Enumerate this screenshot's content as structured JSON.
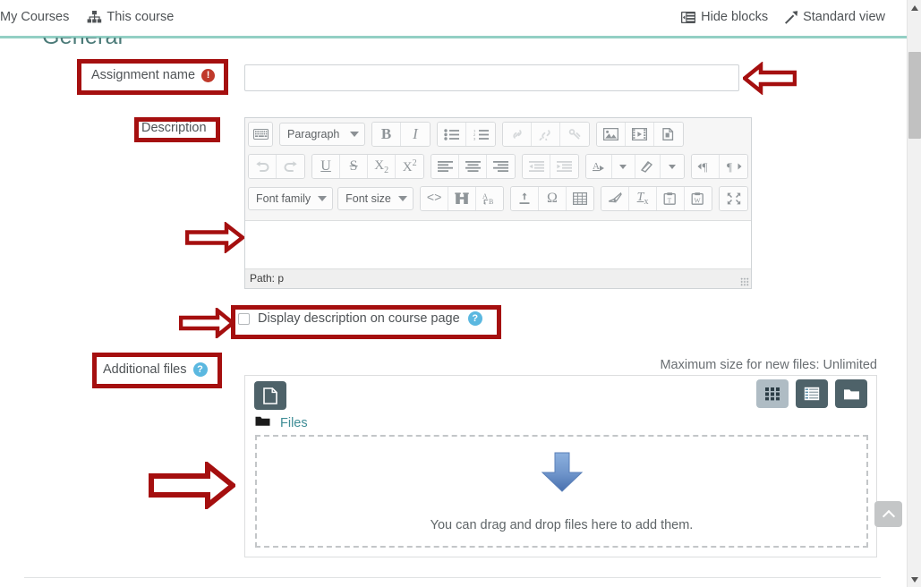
{
  "nav": {
    "left_items": [
      {
        "label": "My Courses",
        "icon": ""
      },
      {
        "label": "This course",
        "icon": "sitemap-icon"
      }
    ],
    "right_items": [
      {
        "label": "Hide blocks",
        "icon": "hide-blocks-icon"
      },
      {
        "label": "Standard view",
        "icon": "standard-view-icon"
      }
    ]
  },
  "section": {
    "heading": "General"
  },
  "assignment_name": {
    "label": "Assignment name",
    "required_marker": "!",
    "value": "",
    "placeholder": ""
  },
  "description": {
    "label": "Description",
    "content": "",
    "path_label": "Path: p",
    "toolbar": {
      "row1": [
        {
          "name": "keyboard-icon",
          "label": "⌨"
        },
        {
          "name": "paragraph-style-select",
          "label": "Paragraph"
        },
        {
          "name": "bold-icon",
          "label": "B"
        },
        {
          "name": "italic-icon",
          "label": "I"
        },
        {
          "name": "bullet-list-icon",
          "label": "≡"
        },
        {
          "name": "numbered-list-icon",
          "label": "≡"
        },
        {
          "name": "link-icon",
          "label": "⚭"
        },
        {
          "name": "unlink-icon",
          "label": "⚭"
        },
        {
          "name": "anchor-icon",
          "label": "⚭"
        },
        {
          "name": "image-icon",
          "label": "⛰"
        },
        {
          "name": "media-icon",
          "label": "▶"
        },
        {
          "name": "manage-files-icon",
          "label": "❐"
        }
      ],
      "row2": [
        {
          "name": "undo-icon",
          "label": "↶"
        },
        {
          "name": "redo-icon",
          "label": "↷"
        },
        {
          "name": "underline-icon",
          "label": "U"
        },
        {
          "name": "strikethrough-icon",
          "label": "S"
        },
        {
          "name": "subscript-icon",
          "label": "X₂"
        },
        {
          "name": "superscript-icon",
          "label": "X²"
        },
        {
          "name": "align-left-icon",
          "label": "≡"
        },
        {
          "name": "align-center-icon",
          "label": "≡"
        },
        {
          "name": "align-right-icon",
          "label": "≡"
        },
        {
          "name": "outdent-icon",
          "label": "≡"
        },
        {
          "name": "indent-icon",
          "label": "≡"
        },
        {
          "name": "text-color-icon",
          "label": "A"
        },
        {
          "name": "text-color-caret",
          "label": "▾"
        },
        {
          "name": "highlight-color-icon",
          "label": "✎"
        },
        {
          "name": "highlight-color-caret",
          "label": "▾"
        },
        {
          "name": "ltr-icon",
          "label": "¶"
        },
        {
          "name": "rtl-icon",
          "label": "¶"
        }
      ],
      "row3": [
        {
          "name": "font-family-select",
          "label": "Font family"
        },
        {
          "name": "font-size-select",
          "label": "Font size"
        },
        {
          "name": "html-source-icon",
          "label": "<>"
        },
        {
          "name": "accessibility-checker-icon",
          "label": "⚖"
        },
        {
          "name": "screenreader-helper-icon",
          "label": "A↵B"
        },
        {
          "name": "insert-horizontal-rule-icon",
          "label": "⤓"
        },
        {
          "name": "special-character-icon",
          "label": "Ω"
        },
        {
          "name": "table-icon",
          "label": "☷"
        },
        {
          "name": "clear-formatting-icon",
          "label": "✐"
        },
        {
          "name": "remove-format-icon",
          "label": "Tx"
        },
        {
          "name": "paste-text-icon",
          "label": "⎘"
        },
        {
          "name": "paste-word-icon",
          "label": "⎘"
        },
        {
          "name": "fullscreen-icon",
          "label": "⛶"
        }
      ]
    }
  },
  "display_description": {
    "label": "Display description on course page",
    "checked": false,
    "help_marker": "?"
  },
  "additional_files": {
    "label": "Additional files",
    "help_marker": "?",
    "max_size_text": "Maximum size for new files: Unlimited",
    "breadcrumb_label": "Files",
    "dropzone_text": "You can drag and drop files here to add them.",
    "view_buttons": [
      {
        "name": "view-icons-button",
        "active": true
      },
      {
        "name": "view-list-button",
        "active": false
      },
      {
        "name": "view-tree-button",
        "active": false
      }
    ]
  },
  "colors": {
    "annotation_red": "#a50f0f",
    "teal_rule": "#93cfc4",
    "heading_teal": "#4b7a78",
    "link_teal": "#3f8d96",
    "required_red": "#c0392b",
    "help_blue": "#5bb8e0",
    "filemanager_dark": "#4e6269",
    "drop_arrow_blue": "#6f9bd4"
  },
  "scroll": {
    "back_to_top": "back-to-top"
  }
}
